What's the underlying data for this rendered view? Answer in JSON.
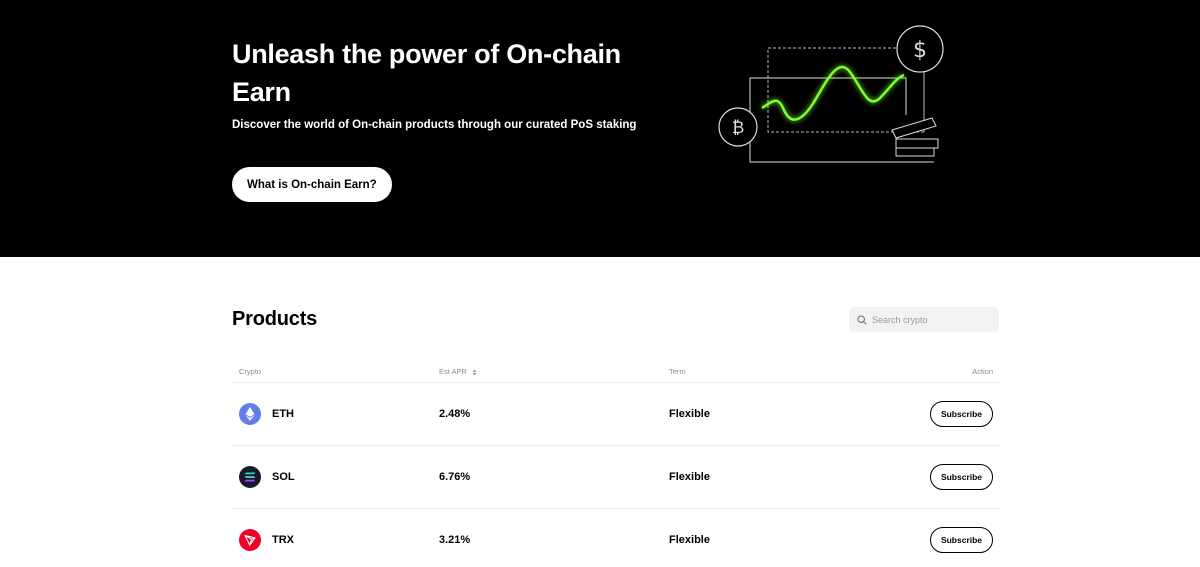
{
  "hero": {
    "title": "Unleash the power of On-chain Earn",
    "subtitle": "Discover the world of On-chain products through our curated PoS staking",
    "cta_label": "What is On-chain Earn?"
  },
  "products": {
    "title": "Products",
    "search_placeholder": "Search crypto",
    "columns": {
      "crypto": "Crypto",
      "apr": "Est APR",
      "term": "Term",
      "action": "Action"
    },
    "rows": [
      {
        "symbol": "ETH",
        "apr": "2.48%",
        "term": "Flexible",
        "action": "Subscribe",
        "icon": "ethereum-icon",
        "color": "#627EEA"
      },
      {
        "symbol": "SOL",
        "apr": "6.76%",
        "term": "Flexible",
        "action": "Subscribe",
        "icon": "solana-icon",
        "color": "#1A1A2E"
      },
      {
        "symbol": "TRX",
        "apr": "3.21%",
        "term": "Flexible",
        "action": "Subscribe",
        "icon": "tron-icon",
        "color": "#EF0027"
      }
    ]
  },
  "colors": {
    "hero_bg": "#000000",
    "accent_green": "#7CFF2B"
  }
}
